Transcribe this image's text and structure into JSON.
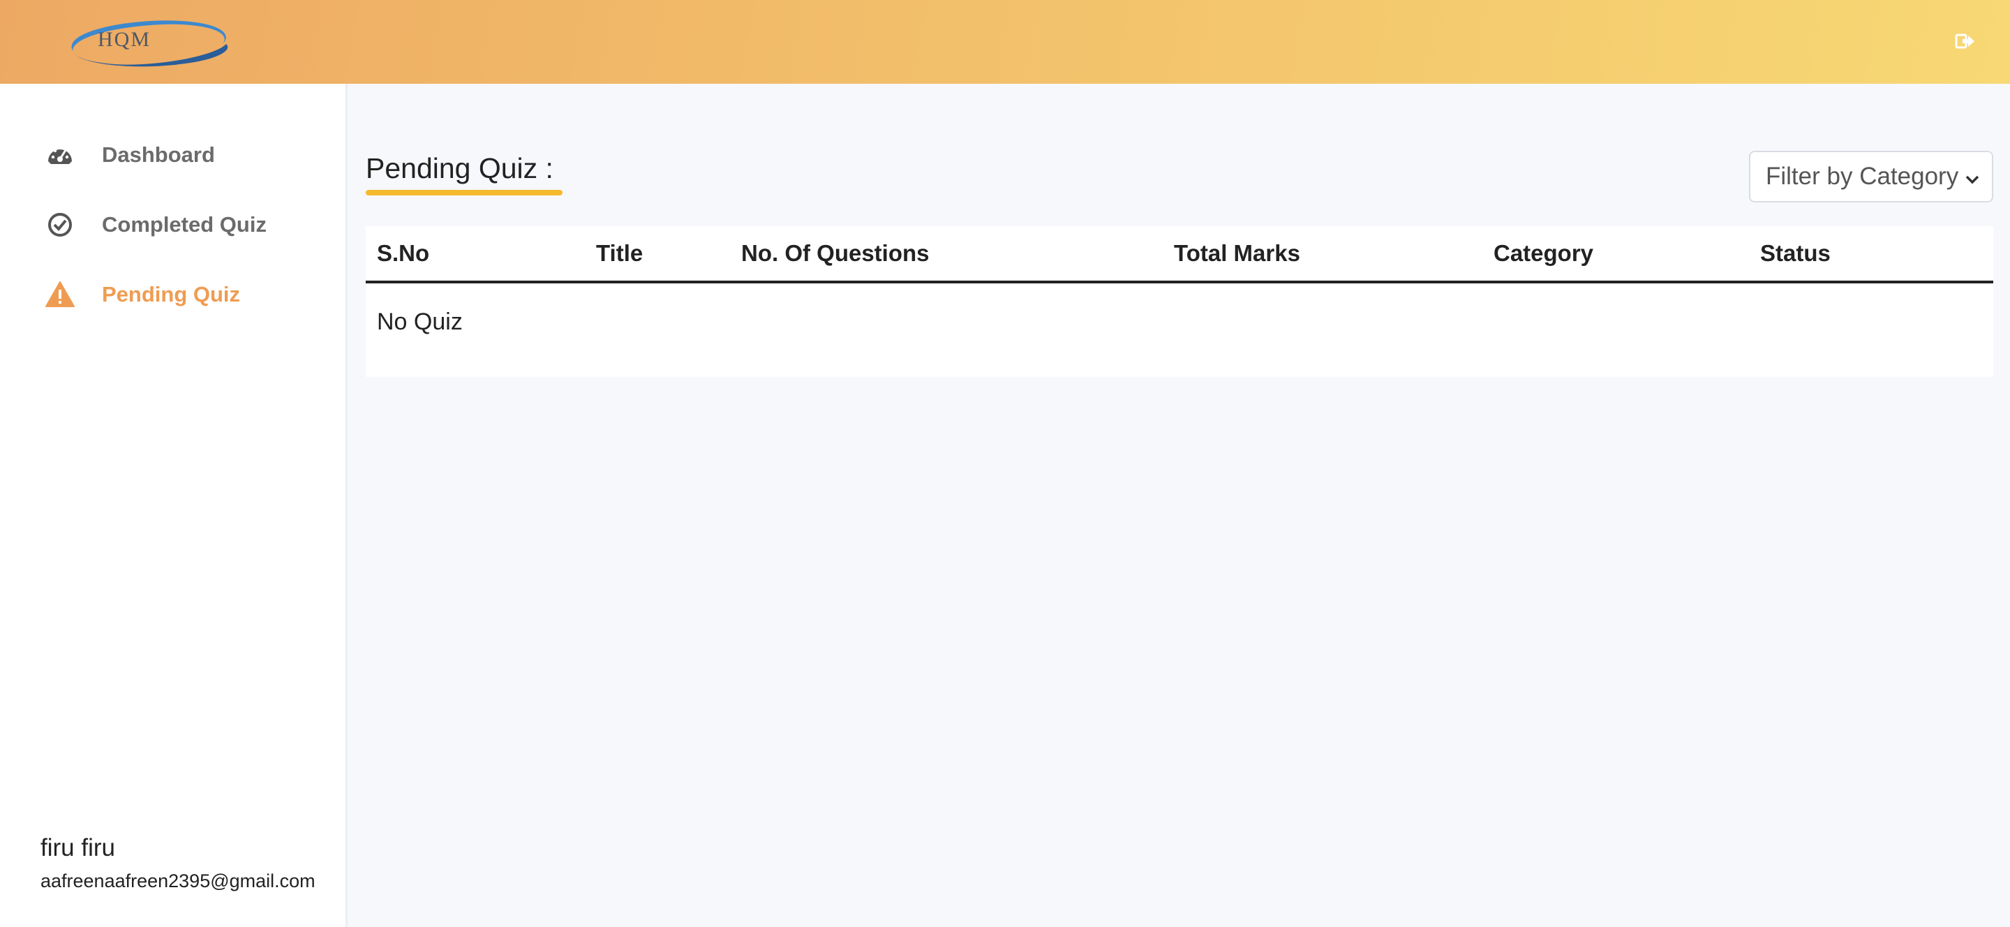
{
  "header": {
    "logo_text": "HQM",
    "logout_icon": "sign-out-icon"
  },
  "sidebar": {
    "items": [
      {
        "label": "Dashboard",
        "icon": "tachometer-icon",
        "active": false
      },
      {
        "label": "Completed Quiz",
        "icon": "check-circle-icon",
        "active": false
      },
      {
        "label": "Pending Quiz",
        "icon": "warning-icon",
        "active": true
      }
    ],
    "user": {
      "name": "firu firu",
      "email": "aafreenaafreen2395@gmail.com"
    }
  },
  "main": {
    "title": "Pending Quiz :",
    "filter": {
      "selected": "Filter by Category"
    },
    "table": {
      "columns": [
        "S.No",
        "Title",
        "No. Of Questions",
        "Total Marks",
        "Category",
        "Status"
      ],
      "empty_text": "No Quiz"
    }
  },
  "colors": {
    "accent": "#ef9c52",
    "underline": "#f5b92f",
    "header_start": "#eda963",
    "header_end": "#f7d874"
  }
}
